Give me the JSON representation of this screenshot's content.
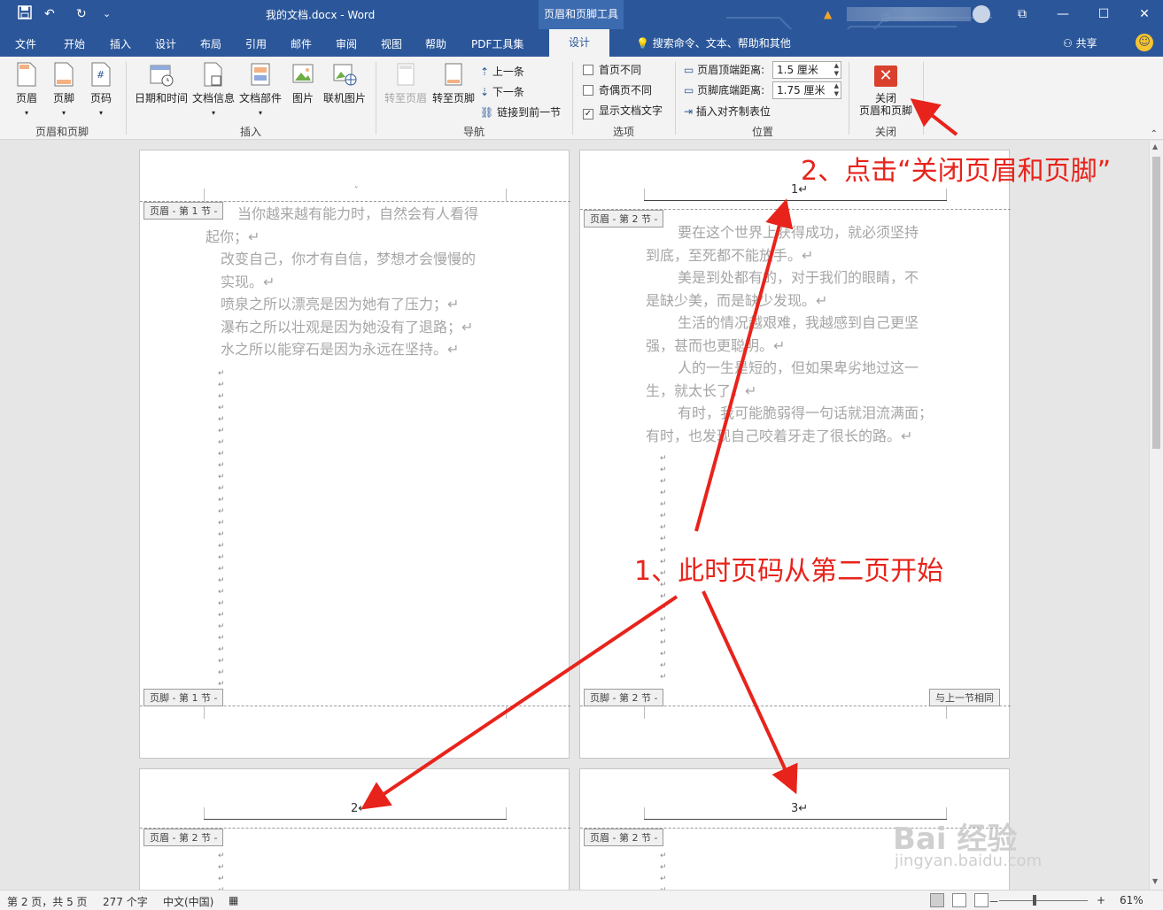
{
  "titlebar": {
    "doc_title": "我的文档.docx  -  Word",
    "context_tool": "页眉和页脚工具",
    "qa_save": "save-icon",
    "qa_undo": "↶",
    "qa_redo": "↻",
    "qa_more": "⌄",
    "win_restore": "⧉",
    "win_min": "—",
    "win_max": "☐",
    "win_close": "✕"
  },
  "tabs": [
    "文件",
    "开始",
    "插入",
    "设计",
    "布局",
    "引用",
    "邮件",
    "审阅",
    "视图",
    "帮助",
    "PDF工具集"
  ],
  "active_tab": "设计",
  "search_tip": "搜索命令、文本、帮助和其他",
  "share": "共享",
  "ribbon": {
    "hf_group": {
      "label": "页眉和页脚",
      "header": "页眉",
      "footer": "页脚",
      "pagenum": "页码"
    },
    "insert_group": {
      "label": "插入",
      "datetime": "日期和时间",
      "docinfo": "文档信息",
      "parts": "文档部件",
      "picture": "图片",
      "online_picture": "联机图片"
    },
    "nav_group": {
      "label": "导航",
      "goto_header": "转至页眉",
      "goto_footer": "转至页脚",
      "prev": "上一条",
      "next": "下一条",
      "link_prev": "链接到前一节"
    },
    "options_group": {
      "label": "选项",
      "diff_first": "首页不同",
      "diff_odd_even": "奇偶页不同",
      "show_doc_text": "显示文档文字",
      "show_doc_text_checked": true
    },
    "position_group": {
      "label": "位置",
      "header_top": "页眉顶端距离:",
      "header_top_value": "1.5 厘米",
      "footer_bottom": "页脚底端距离:",
      "footer_bottom_value": "1.75 厘米",
      "insert_align_tab": "插入对齐制表位"
    },
    "close_group": {
      "label": "关闭",
      "close_line1": "关闭",
      "close_line2": "页眉和页脚"
    }
  },
  "pages": {
    "p1": {
      "header_tag": "页眉 - 第 1 节 -",
      "footer_tag": "页脚 - 第 1 节 -",
      "lines": [
        "当你越来越有能力时，自然会有人看得",
        "起你；↵",
        "改变自己，你才有自信，梦想才会慢慢的",
        "实现。↵",
        "喷泉之所以漂亮是因为她有了压力；↵",
        "瀑布之所以壮观是因为她没有了退路；↵",
        "水之所以能穿石是因为永远在坚持。↵"
      ]
    },
    "p2": {
      "header_tag": "页眉 - 第 2 节 -",
      "footer_tag": "页脚 - 第 2 节 -",
      "same_as_prev": "与上一节相同",
      "page_number": "1↵",
      "lines": [
        "要在这个世界上获得成功，就必须坚持",
        "到底，至死都不能放手。↵",
        "美是到处都有的，对于我们的眼睛，不",
        "是缺少美，而是缺少发现。↵",
        "生活的情况越艰难，我越感到自己更坚",
        "强，甚而也更聪明。↵",
        "人的一生是短的，但如果卑劣地过这一",
        "生，就太长了。↵",
        "有时，我可能脆弱得一句话就泪流满面；",
        "有时，也发现自己咬着牙走了很长的路。↵"
      ]
    },
    "p3": {
      "header_tag": "页眉 - 第 2 节 -",
      "page_number": "2↵"
    },
    "p4": {
      "header_tag": "页眉 - 第 2 节 -",
      "page_number": "3↵"
    }
  },
  "annotations": {
    "note1": "1、此时页码从第二页开始",
    "note2": "2、点击“关闭页眉和页脚”"
  },
  "statusbar": {
    "page": "第 2 页，共 5 页",
    "words": "277 个字",
    "lang": "中文(中国)",
    "zoom": "61%",
    "zoom_minus": "－",
    "zoom_plus": "+"
  },
  "watermark": {
    "line1": "Bai 经验",
    "line2": "jingyan.baidu.com"
  },
  "colors": {
    "word_blue": "#2b579a",
    "annotation_red": "#e8231b",
    "close_red": "#d9412e"
  }
}
